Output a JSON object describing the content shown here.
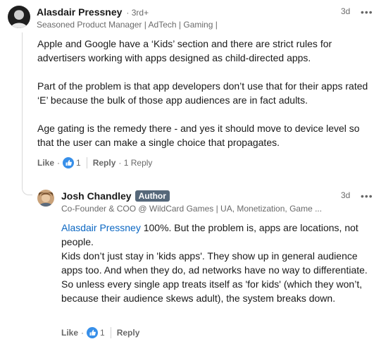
{
  "comment": {
    "author_name": "Alasdair Pressney",
    "degree": "· 3rd+",
    "headline": "Seasoned Product Manager | AdTech | Gaming |",
    "time": "3d",
    "more_label": "•••",
    "paragraphs": [
      "Apple and Google have a ‘Kids’ section and there are strict rules for advertisers working with apps designed as child-directed apps.",
      "Part of the problem is that app developers don’t use that for their apps rated ‘E’ because the bulk of those app audiences are in fact adults.",
      "Age gating is the remedy there - and yes it should move to device level so that the user can make a single choice that propagates."
    ],
    "like_label": "Like",
    "dot": "·",
    "reaction_count": "1",
    "reply_label": "Reply",
    "reply_count": "· 1 Reply"
  },
  "reply": {
    "author_name": "Josh Chandley",
    "badge": "Author",
    "headline": "Co-Founder & COO @ WildCard Games | UA, Monetization, Game ...",
    "time": "3d",
    "more_label": "•••",
    "mention": "Alasdair Pressney",
    "line1_rest": " 100%. But the problem is, apps are locations, not people.",
    "line2": "Kids don’t just stay in 'kids apps'. They show up in general audience apps too. And when they do, ad networks have no way to differentiate.",
    "line3": "So unless every single app treats itself as 'for kids' (which they won’t, because their audience skews adult), the system breaks down.",
    "like_label": "Like",
    "dot": "·",
    "reaction_count": "1",
    "reply_label": "Reply"
  },
  "colors": {
    "link": "#0a66c2",
    "badge_bg": "#56687a",
    "like_icon_blue": "#378fe9"
  },
  "icons": {
    "reaction": "thumbs-up-icon",
    "more": "more-horizontal-icon"
  }
}
